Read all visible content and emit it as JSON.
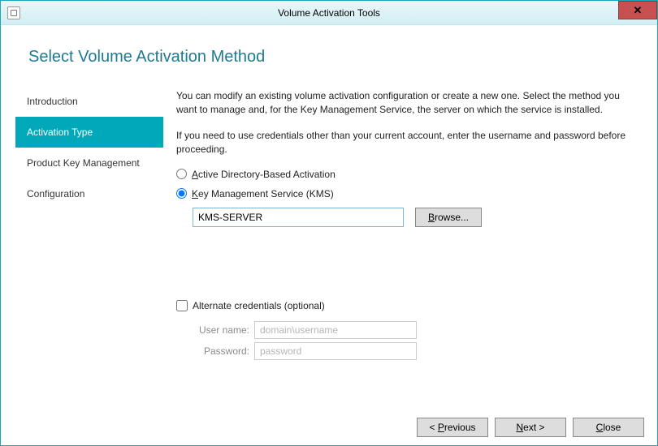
{
  "window": {
    "title": "Volume Activation Tools",
    "close_glyph": "✕"
  },
  "heading": "Select Volume Activation Method",
  "sidebar": {
    "items": [
      {
        "label": "Introduction",
        "active": false
      },
      {
        "label": "Activation Type",
        "active": true
      },
      {
        "label": "Product Key Management",
        "active": false
      },
      {
        "label": "Configuration",
        "active": false
      }
    ]
  },
  "content": {
    "para1": "You can modify an existing volume activation configuration or create a new one. Select the method you want to manage and, for the Key Management Service, the server on which the service is installed.",
    "para2": "If you need to use credentials other than your current account, enter the username and password before proceeding.",
    "radio_ad_html": "<u class='access'>A</u>ctive Directory-Based Activation",
    "radio_kms_html": "<u class='access'>K</u>ey Management Service (KMS)",
    "selected": "kms",
    "server_value": "KMS-SERVER",
    "browse_html": "<u class='access'>B</u>rowse...",
    "alt_label": "Alternate credentials (optional)",
    "alt_checked": false,
    "username_label": "User name:",
    "username_placeholder": "domain\\username",
    "password_label": "Password:",
    "password_placeholder": "password"
  },
  "footer": {
    "previous_html": "&lt; <u class='access'>P</u>revious",
    "next_html": "<u class='access'>N</u>ext &gt;",
    "close_html": "<u class='access'>C</u>lose"
  }
}
